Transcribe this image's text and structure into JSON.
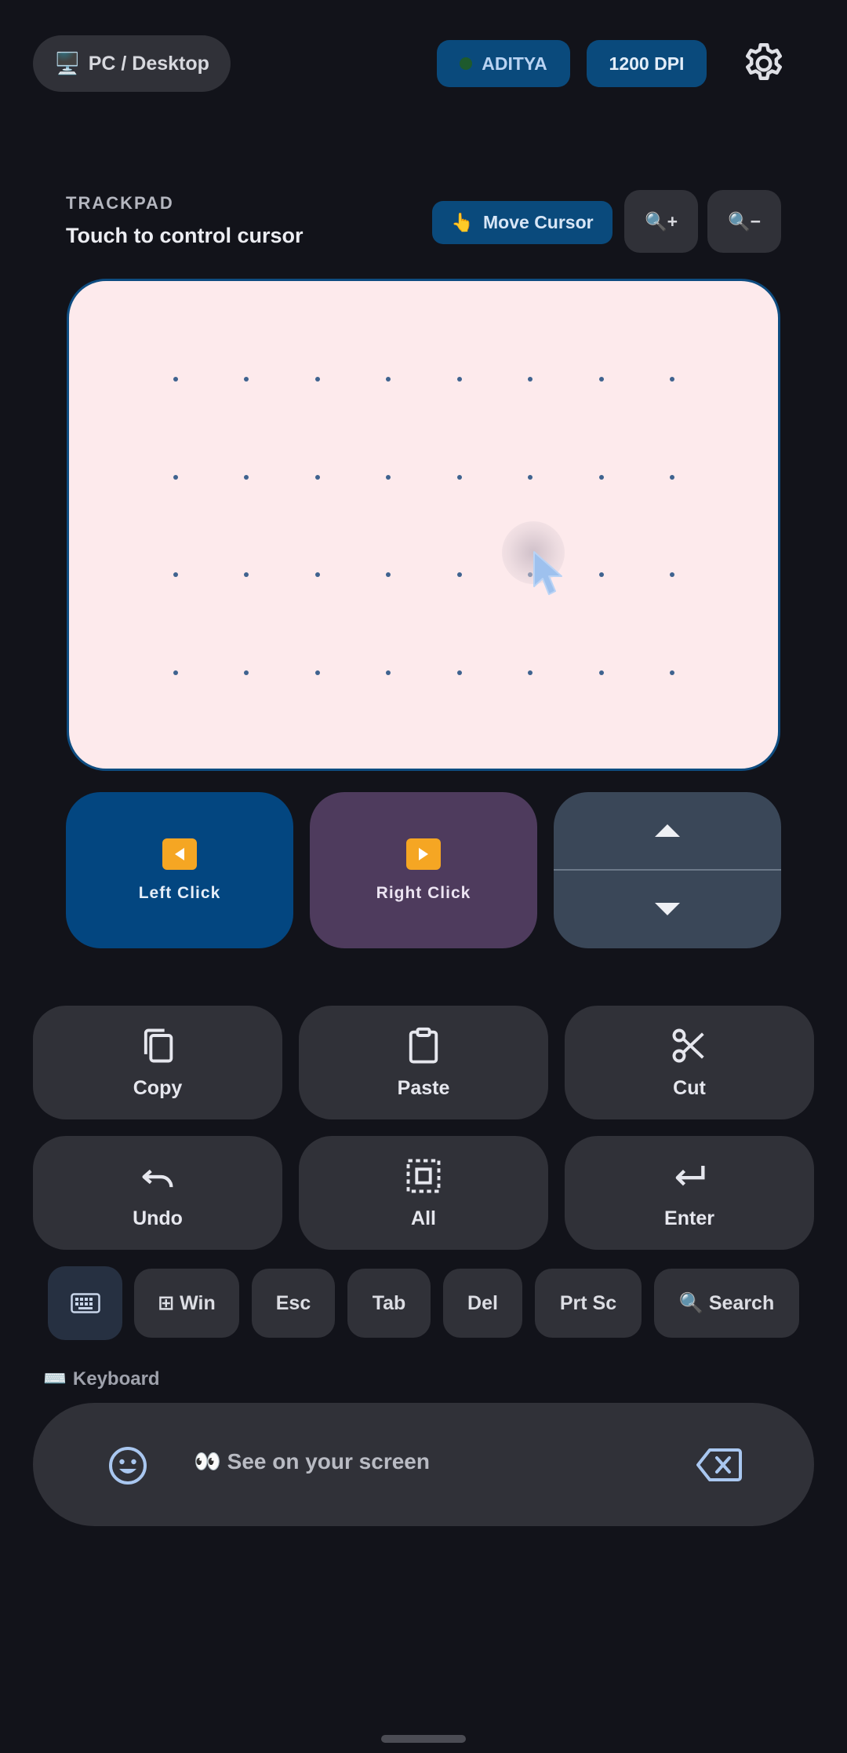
{
  "top_bar": {
    "device_emoji": "🖥️",
    "device_label": "PC / Desktop",
    "user_name": "ADITYA",
    "dpi_label": "1200 DPI",
    "settings_icon": "gear-icon"
  },
  "trackpad": {
    "section_label": "TRACKPAD",
    "subtitle": "Touch to control cursor",
    "move_emoji": "👆",
    "move_label": "Move Cursor",
    "zoom_in_label": "🔍+",
    "zoom_out_label": "🔍−"
  },
  "mouse": {
    "left_click_label": "Left Click",
    "right_click_label": "Right Click",
    "scroll_up_icon": "triangle-up-icon",
    "scroll_down_icon": "triangle-down-icon"
  },
  "actions": [
    {
      "label": "Copy",
      "icon": "copy-icon"
    },
    {
      "label": "Paste",
      "icon": "clipboard-icon"
    },
    {
      "label": "Cut",
      "icon": "scissors-icon"
    },
    {
      "label": "Undo",
      "icon": "undo-icon"
    },
    {
      "label": "All",
      "icon": "select-all-icon"
    },
    {
      "label": "Enter",
      "icon": "enter-icon"
    }
  ],
  "keys": {
    "keyboard_icon": "keyboard-icon",
    "win": "⊞ Win",
    "esc": "Esc",
    "tab": "Tab",
    "del": "Del",
    "prtsc": "Prt Sc",
    "search": "🔍 Search"
  },
  "keyboard": {
    "section_emoji": "⌨️",
    "section_label": "Keyboard",
    "input_text": "👀 See on your screen",
    "emoji_icon": "smiley-icon",
    "backspace_icon": "backspace-icon"
  },
  "colors": {
    "background": "#12131a",
    "accent_blue": "#0a4a7c",
    "right_click": "#4e3b5d",
    "trackpad_surface": "#fdeaec",
    "button_gray": "#303138"
  }
}
